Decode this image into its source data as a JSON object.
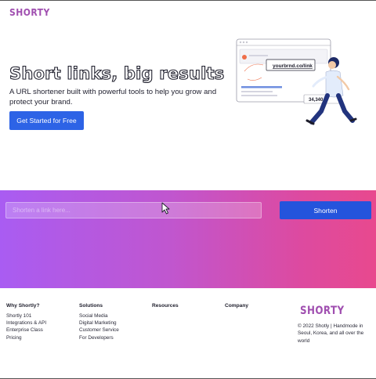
{
  "header": {
    "logo": "SHORTY"
  },
  "hero": {
    "title": "Short links, big results",
    "subtitle": "A URL shortener built with powerful tools to help you grow and protect your brand.",
    "cta_label": "Get Started for Free",
    "illustration": {
      "url_text": "yourbrnd.co/link",
      "stat_value": "34,340"
    }
  },
  "shortener": {
    "input_value": "",
    "input_placeholder": "Shorten a link here...",
    "button_label": "Shorten"
  },
  "footer": {
    "columns": [
      {
        "heading": "Why Shortly?",
        "links": [
          "Shortly 101",
          "Integrations & API",
          "Enterprise Class",
          "Pricing"
        ]
      },
      {
        "heading": "Solutions",
        "links": [
          "Social Media",
          "Digital Marketing",
          "Customer Service",
          "For Developers"
        ]
      },
      {
        "heading": "Resources",
        "links": []
      },
      {
        "heading": "Company",
        "links": []
      }
    ],
    "logo": "SHORTY",
    "copyright": "© 2022 Shotly | Handmode in Seoul, Korea, and all over the world"
  },
  "colors": {
    "brand": "#a04fb0",
    "primary_button": "#2d63e6",
    "gradient_start": "#a95cf2",
    "gradient_end": "#e8498e"
  }
}
